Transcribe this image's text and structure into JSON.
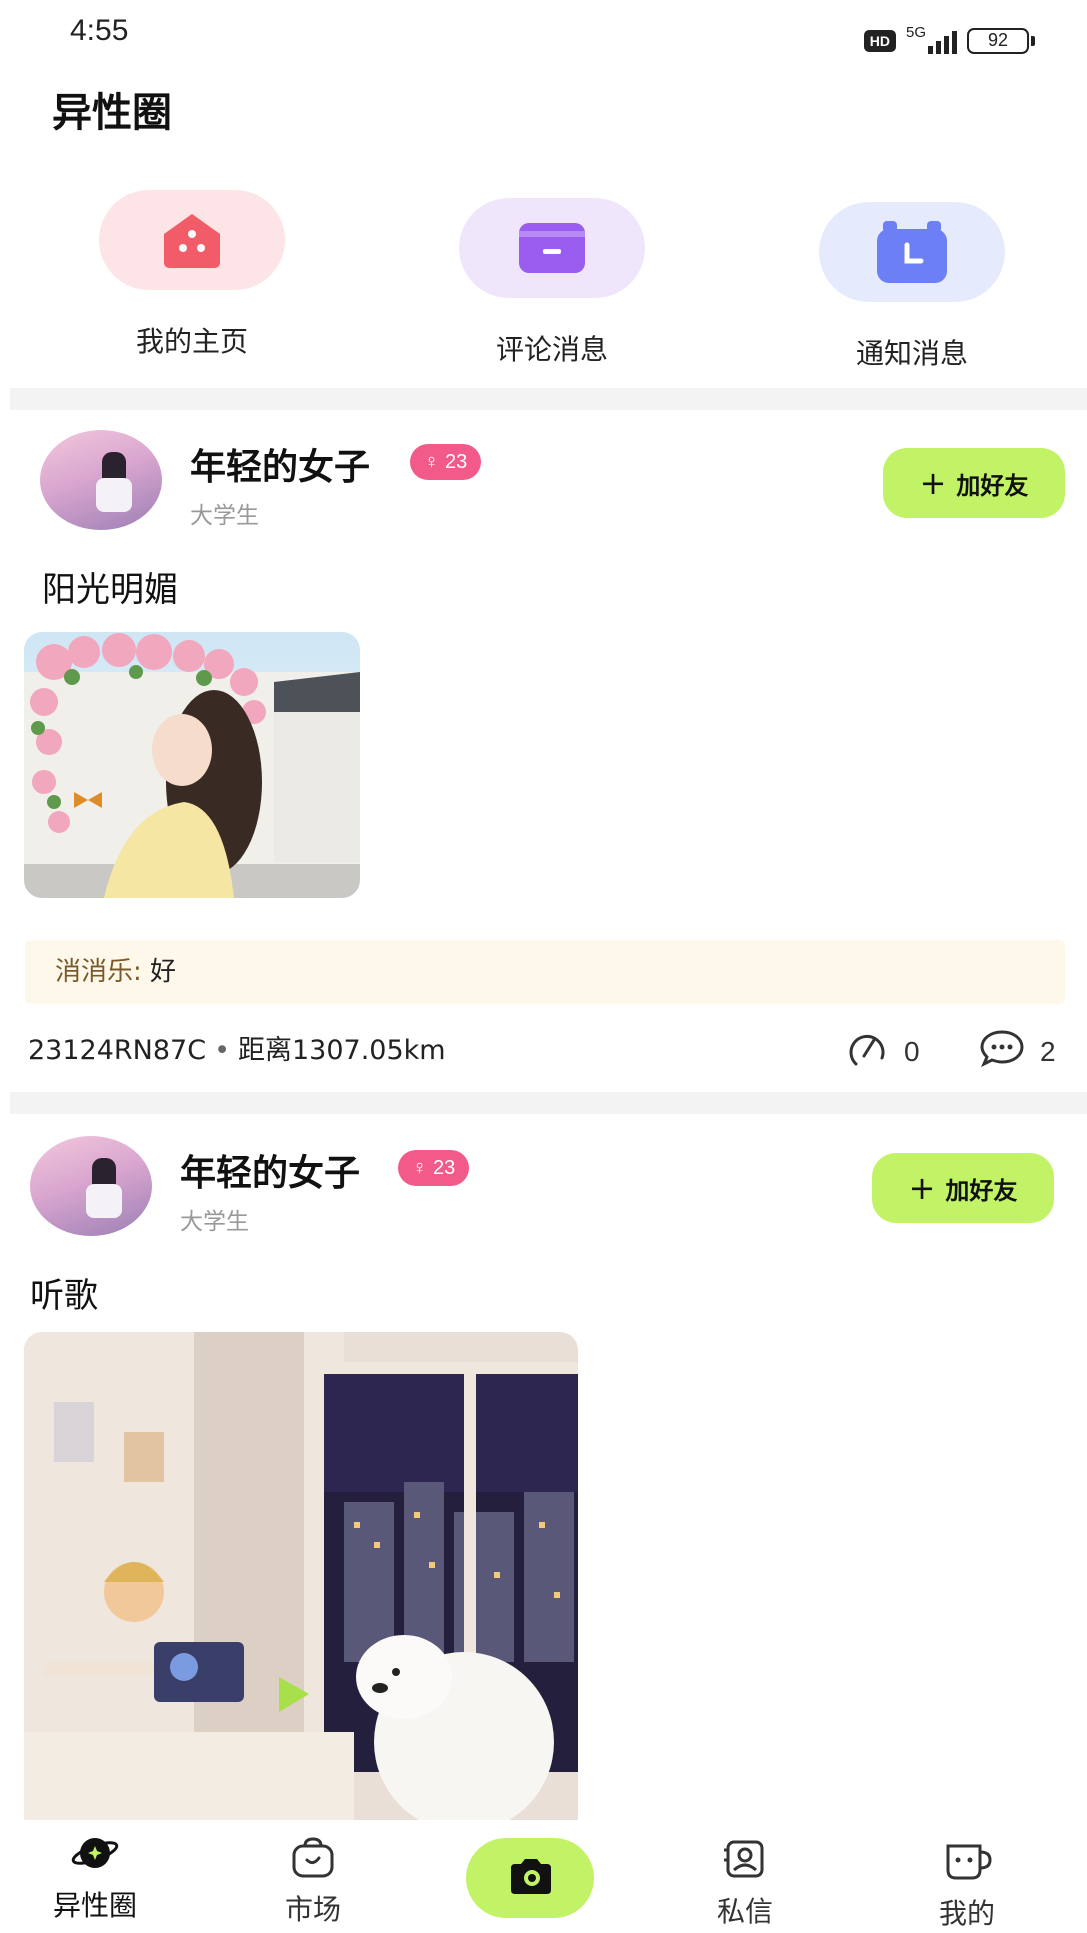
{
  "status_bar": {
    "time": "4:55",
    "hd": "HD",
    "network": "5G",
    "battery": "92"
  },
  "page_title": "异性圈",
  "quick_actions": [
    {
      "label": "我的主页",
      "icon": "home-icon",
      "color": "#f25c68"
    },
    {
      "label": "评论消息",
      "icon": "message-card-icon",
      "color": "#9b5cf0"
    },
    {
      "label": "通知消息",
      "icon": "calendar-clock-icon",
      "color": "#6c7ff5"
    }
  ],
  "posts": [
    {
      "username": "年轻的女子",
      "badge": "23",
      "badge_icon": "female-icon",
      "subtitle": "大学生",
      "add_friend": "加好友",
      "text": "阳光明媚",
      "image": "girl-with-roses-illustration",
      "comment": {
        "name": "消消乐",
        "separator": ": ",
        "text": "好"
      },
      "device": "23124RN87C",
      "distance": "距离1307.05km",
      "likes": "0",
      "comments": "2"
    },
    {
      "username": "年轻的女子",
      "badge": "23",
      "badge_icon": "female-icon",
      "subtitle": "大学生",
      "add_friend": "加好友",
      "text": "听歌",
      "image": "room-with-bear-illustration"
    }
  ],
  "tabbar": {
    "items": [
      {
        "label": "异性圈",
        "icon": "planet-icon",
        "active": true
      },
      {
        "label": "市场",
        "icon": "bag-icon"
      },
      {
        "label": "",
        "icon": "camera-icon"
      },
      {
        "label": "私信",
        "icon": "contact-card-icon"
      },
      {
        "label": "我的",
        "icon": "cup-face-icon"
      }
    ],
    "accent": "#c2f367"
  }
}
